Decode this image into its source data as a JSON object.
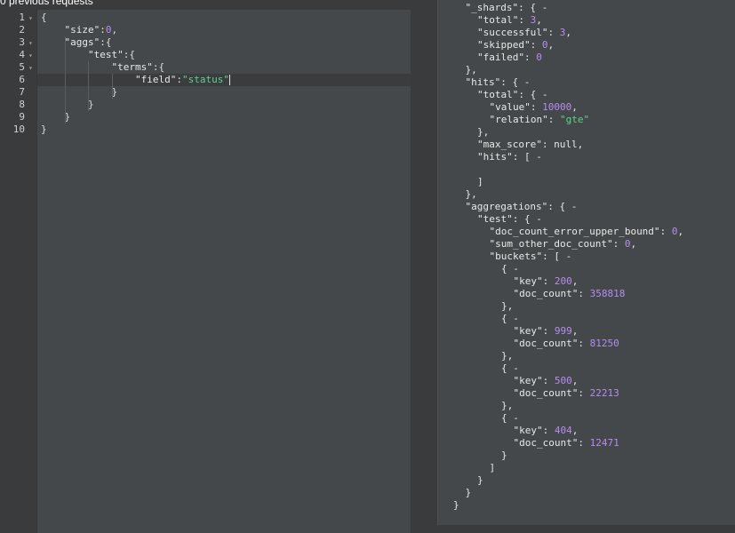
{
  "header": {
    "history_label": "0 previous requests"
  },
  "colors": {
    "editor_bg": "#45484a",
    "gutter_bg": "#393b3d",
    "number": "#b48ef0",
    "string": "#5fd28f"
  },
  "editor": {
    "lines": [
      {
        "num": "1",
        "fold": true,
        "active": false,
        "indent": 0,
        "parts": [
          [
            "p",
            "{"
          ]
        ]
      },
      {
        "num": "2",
        "fold": false,
        "active": false,
        "indent": 1,
        "parts": [
          [
            "k",
            "\"size\""
          ],
          [
            "p",
            ":"
          ],
          [
            "n",
            "0"
          ],
          [
            "p",
            ","
          ]
        ]
      },
      {
        "num": "3",
        "fold": true,
        "active": false,
        "indent": 1,
        "parts": [
          [
            "k",
            "\"aggs\""
          ],
          [
            "p",
            ":{"
          ]
        ]
      },
      {
        "num": "4",
        "fold": true,
        "active": false,
        "indent": 2,
        "parts": [
          [
            "k",
            "\"test\""
          ],
          [
            "p",
            ":{"
          ]
        ]
      },
      {
        "num": "5",
        "fold": true,
        "active": false,
        "indent": 3,
        "parts": [
          [
            "k",
            "\"terms\""
          ],
          [
            "p",
            ":{"
          ]
        ]
      },
      {
        "num": "6",
        "fold": false,
        "active": true,
        "indent": 4,
        "parts": [
          [
            "k",
            "\"field\""
          ],
          [
            "p",
            ":"
          ],
          [
            "s",
            "\"status\""
          ]
        ],
        "cursor": true
      },
      {
        "num": "7",
        "fold": false,
        "active": false,
        "indent": 3,
        "parts": [
          [
            "p",
            "}"
          ]
        ]
      },
      {
        "num": "8",
        "fold": false,
        "active": false,
        "indent": 2,
        "parts": [
          [
            "p",
            "}"
          ]
        ]
      },
      {
        "num": "9",
        "fold": false,
        "active": false,
        "indent": 1,
        "parts": [
          [
            "p",
            "}"
          ]
        ]
      },
      {
        "num": "10",
        "fold": false,
        "active": false,
        "indent": 0,
        "parts": [
          [
            "p",
            "}"
          ]
        ]
      }
    ]
  },
  "response": {
    "lines": [
      {
        "indent": 1,
        "parts": [
          [
            "k",
            "\"_shards\""
          ],
          [
            "p",
            ": { -"
          ]
        ]
      },
      {
        "indent": 2,
        "parts": [
          [
            "k",
            "\"total\""
          ],
          [
            "p",
            ": "
          ],
          [
            "n",
            "3"
          ],
          [
            "p",
            ","
          ]
        ]
      },
      {
        "indent": 2,
        "parts": [
          [
            "k",
            "\"successful\""
          ],
          [
            "p",
            ": "
          ],
          [
            "n",
            "3"
          ],
          [
            "p",
            ","
          ]
        ]
      },
      {
        "indent": 2,
        "parts": [
          [
            "k",
            "\"skipped\""
          ],
          [
            "p",
            ": "
          ],
          [
            "n",
            "0"
          ],
          [
            "p",
            ","
          ]
        ]
      },
      {
        "indent": 2,
        "parts": [
          [
            "k",
            "\"failed\""
          ],
          [
            "p",
            ": "
          ],
          [
            "n",
            "0"
          ]
        ]
      },
      {
        "indent": 1,
        "parts": [
          [
            "p",
            "},"
          ]
        ]
      },
      {
        "indent": 1,
        "parts": [
          [
            "k",
            "\"hits\""
          ],
          [
            "p",
            ": { -"
          ]
        ]
      },
      {
        "indent": 2,
        "parts": [
          [
            "k",
            "\"total\""
          ],
          [
            "p",
            ": { -"
          ]
        ]
      },
      {
        "indent": 3,
        "parts": [
          [
            "k",
            "\"value\""
          ],
          [
            "p",
            ": "
          ],
          [
            "n",
            "10000"
          ],
          [
            "p",
            ","
          ]
        ]
      },
      {
        "indent": 3,
        "parts": [
          [
            "k",
            "\"relation\""
          ],
          [
            "p",
            ": "
          ],
          [
            "s",
            "\"gte\""
          ]
        ]
      },
      {
        "indent": 2,
        "parts": [
          [
            "p",
            "},"
          ]
        ]
      },
      {
        "indent": 2,
        "parts": [
          [
            "k",
            "\"max_score\""
          ],
          [
            "p",
            ": null,"
          ]
        ]
      },
      {
        "indent": 2,
        "parts": [
          [
            "k",
            "\"hits\""
          ],
          [
            "p",
            ": [ -"
          ]
        ]
      },
      {
        "indent": 2,
        "parts": []
      },
      {
        "indent": 2,
        "parts": [
          [
            "p",
            "]"
          ]
        ]
      },
      {
        "indent": 1,
        "parts": [
          [
            "p",
            "},"
          ]
        ]
      },
      {
        "indent": 1,
        "parts": [
          [
            "k",
            "\"aggregations\""
          ],
          [
            "p",
            ": { -"
          ]
        ]
      },
      {
        "indent": 2,
        "parts": [
          [
            "k",
            "\"test\""
          ],
          [
            "p",
            ": { -"
          ]
        ]
      },
      {
        "indent": 3,
        "parts": [
          [
            "k",
            "\"doc_count_error_upper_bound\""
          ],
          [
            "p",
            ": "
          ],
          [
            "n",
            "0"
          ],
          [
            "p",
            ","
          ]
        ]
      },
      {
        "indent": 3,
        "parts": [
          [
            "k",
            "\"sum_other_doc_count\""
          ],
          [
            "p",
            ": "
          ],
          [
            "n",
            "0"
          ],
          [
            "p",
            ","
          ]
        ]
      },
      {
        "indent": 3,
        "parts": [
          [
            "k",
            "\"buckets\""
          ],
          [
            "p",
            ": [ -"
          ]
        ]
      },
      {
        "indent": 4,
        "parts": [
          [
            "p",
            "{ -"
          ]
        ]
      },
      {
        "indent": 5,
        "parts": [
          [
            "k",
            "\"key\""
          ],
          [
            "p",
            ": "
          ],
          [
            "n",
            "200"
          ],
          [
            "p",
            ","
          ]
        ]
      },
      {
        "indent": 5,
        "parts": [
          [
            "k",
            "\"doc_count\""
          ],
          [
            "p",
            ": "
          ],
          [
            "n",
            "358818"
          ]
        ]
      },
      {
        "indent": 4,
        "parts": [
          [
            "p",
            "},"
          ]
        ]
      },
      {
        "indent": 4,
        "parts": [
          [
            "p",
            "{ -"
          ]
        ]
      },
      {
        "indent": 5,
        "parts": [
          [
            "k",
            "\"key\""
          ],
          [
            "p",
            ": "
          ],
          [
            "n",
            "999"
          ],
          [
            "p",
            ","
          ]
        ]
      },
      {
        "indent": 5,
        "parts": [
          [
            "k",
            "\"doc_count\""
          ],
          [
            "p",
            ": "
          ],
          [
            "n",
            "81250"
          ]
        ]
      },
      {
        "indent": 4,
        "parts": [
          [
            "p",
            "},"
          ]
        ]
      },
      {
        "indent": 4,
        "parts": [
          [
            "p",
            "{ -"
          ]
        ]
      },
      {
        "indent": 5,
        "parts": [
          [
            "k",
            "\"key\""
          ],
          [
            "p",
            ": "
          ],
          [
            "n",
            "500"
          ],
          [
            "p",
            ","
          ]
        ]
      },
      {
        "indent": 5,
        "parts": [
          [
            "k",
            "\"doc_count\""
          ],
          [
            "p",
            ": "
          ],
          [
            "n",
            "22213"
          ]
        ]
      },
      {
        "indent": 4,
        "parts": [
          [
            "p",
            "},"
          ]
        ]
      },
      {
        "indent": 4,
        "parts": [
          [
            "p",
            "{ -"
          ]
        ]
      },
      {
        "indent": 5,
        "parts": [
          [
            "k",
            "\"key\""
          ],
          [
            "p",
            ": "
          ],
          [
            "n",
            "404"
          ],
          [
            "p",
            ","
          ]
        ]
      },
      {
        "indent": 5,
        "parts": [
          [
            "k",
            "\"doc_count\""
          ],
          [
            "p",
            ": "
          ],
          [
            "n",
            "12471"
          ]
        ]
      },
      {
        "indent": 4,
        "parts": [
          [
            "p",
            "}"
          ]
        ]
      },
      {
        "indent": 3,
        "parts": [
          [
            "p",
            "]"
          ]
        ]
      },
      {
        "indent": 2,
        "parts": [
          [
            "p",
            "}"
          ]
        ]
      },
      {
        "indent": 1,
        "parts": [
          [
            "p",
            "}"
          ]
        ]
      },
      {
        "indent": 0,
        "parts": [
          [
            "p",
            "}"
          ]
        ]
      }
    ]
  }
}
